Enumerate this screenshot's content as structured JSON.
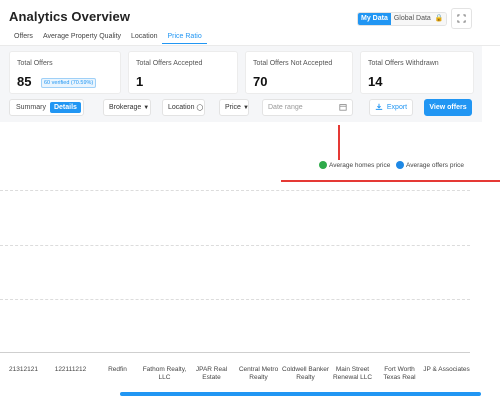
{
  "header": {
    "title": "Analytics Overview",
    "data_toggle": {
      "my_data": "My Data",
      "global_data": "Global Data"
    },
    "expand_icon": "expand-icon"
  },
  "tabs": [
    {
      "label": "Offers",
      "active": false
    },
    {
      "label": "Average Property Quality",
      "active": false
    },
    {
      "label": "Location",
      "active": false
    },
    {
      "label": "Price Ratio",
      "active": true
    }
  ],
  "cards": [
    {
      "label": "Total Offers",
      "value": "85",
      "badge": "60 verified (70.59%)"
    },
    {
      "label": "Total Offers Accepted",
      "value": "1"
    },
    {
      "label": "Total Offers Not Accepted",
      "value": "70"
    },
    {
      "label": "Total Offers Withdrawn",
      "value": "14"
    }
  ],
  "controls": {
    "view": {
      "summary": "Summary",
      "details": "Details"
    },
    "brokerage": "Brokerage",
    "location": "Location",
    "price": "Price",
    "date_placeholder": "Date range",
    "export": "Export",
    "view_offers": "View offers"
  },
  "chart_data": {
    "type": "bar",
    "legend": [
      {
        "name": "Average homes price",
        "color": "#2eaa4a"
      },
      {
        "name": "Average offers price",
        "color": "#1e88e5"
      }
    ],
    "categories": [
      "21312121",
      "122111212",
      "Redfin",
      "Fathom Realty, LLC",
      "JPAR Real Estate",
      "Central Metro Realty",
      "Coldwell Banker Realty",
      "Main Street Renewal LLC",
      "Fort Worth Texas Real",
      "JP & Associates"
    ],
    "series": [
      {
        "name": "Average homes price",
        "values": []
      },
      {
        "name": "Average offers price",
        "values": []
      }
    ],
    "grid": true,
    "legend_position": "top-right"
  },
  "colors": {
    "accent": "#2196f3",
    "annotation": "#e53935"
  }
}
